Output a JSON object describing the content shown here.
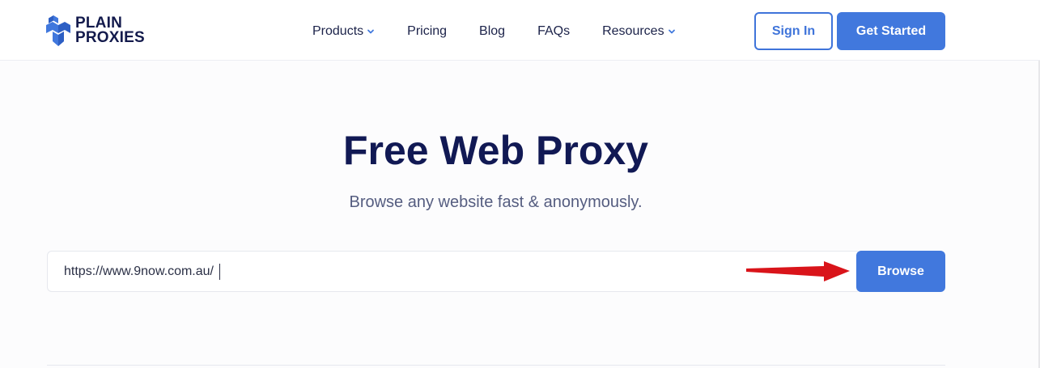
{
  "brand": {
    "line1": "PLAIN",
    "line2": "PROXIES",
    "logo_icon": "cube-logo-icon",
    "color": "#131a4c"
  },
  "nav": {
    "items": [
      {
        "label": "Products",
        "dropdown": true
      },
      {
        "label": "Pricing",
        "dropdown": false
      },
      {
        "label": "Blog",
        "dropdown": false
      },
      {
        "label": "FAQs",
        "dropdown": false
      },
      {
        "label": "Resources",
        "dropdown": true
      }
    ],
    "signin_label": "Sign In",
    "get_started_label": "Get Started"
  },
  "hero": {
    "title": "Free Web Proxy",
    "subtitle": "Browse any website fast & anonymously."
  },
  "search": {
    "value": "https://www.9now.com.au/",
    "placeholder": "",
    "button_label": "Browse"
  },
  "colors": {
    "accent": "#4178dd",
    "title": "#111954",
    "annotation_arrow": "#d9141a"
  }
}
